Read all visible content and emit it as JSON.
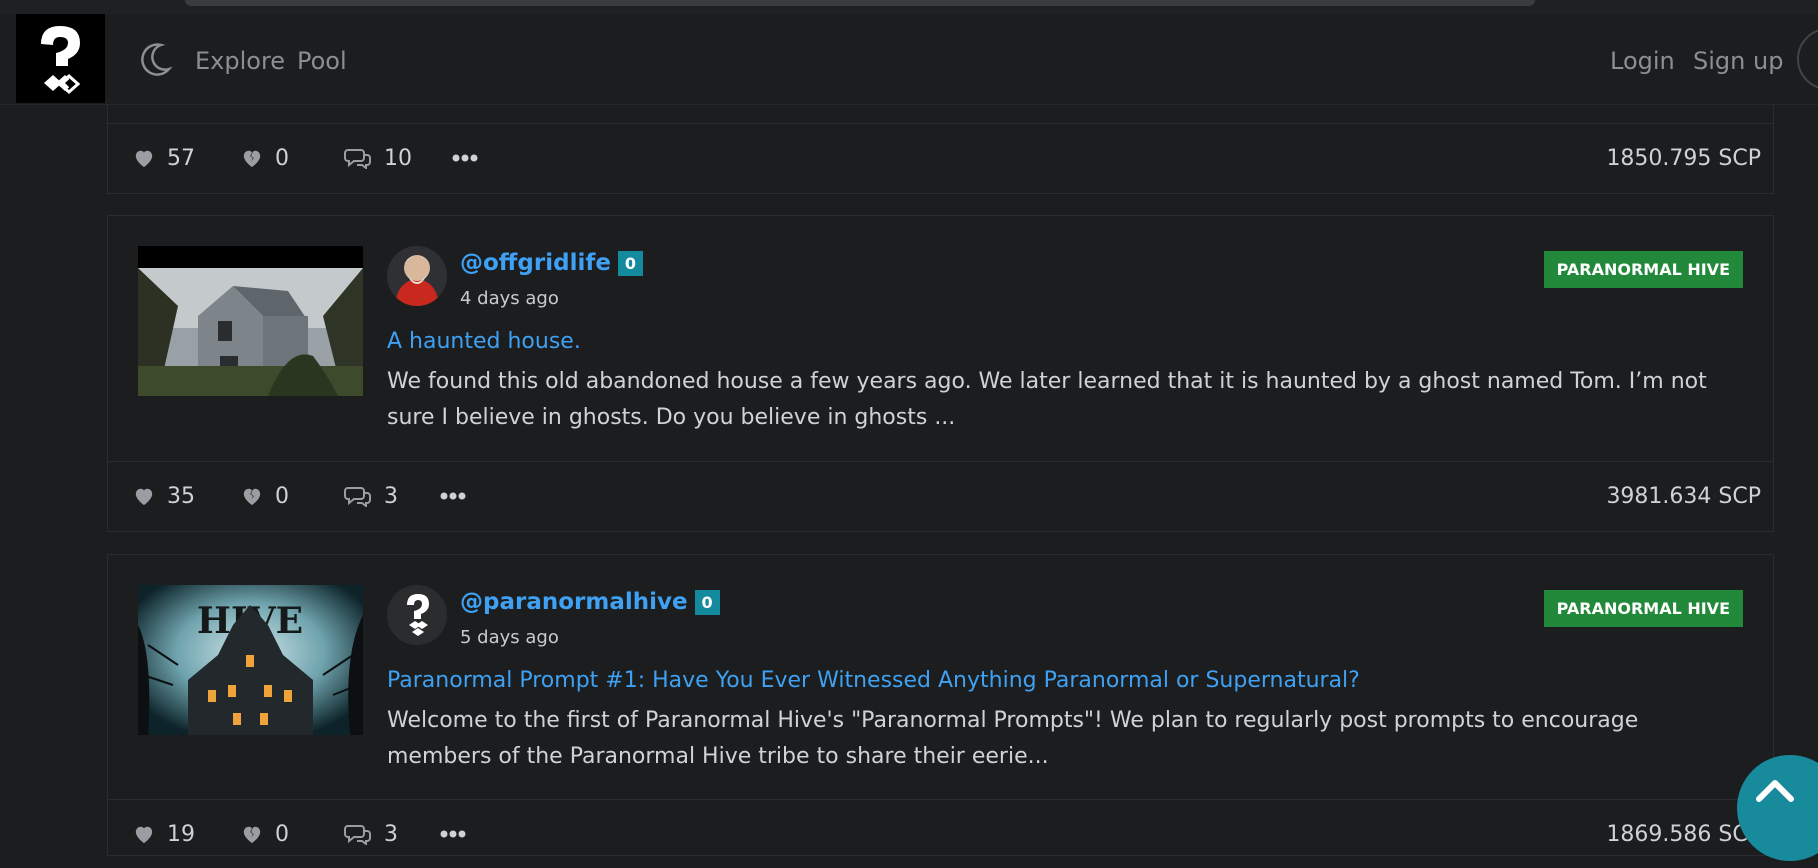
{
  "nav": {
    "links": [
      "Explore",
      "Pool"
    ],
    "login": "Login",
    "signup": "Sign up"
  },
  "posts": [
    {
      "likes": "57",
      "dislikes": "0",
      "comments": "10",
      "payout": "1850.795 SCP"
    },
    {
      "author": "@offgridlife",
      "reputation": "0",
      "time": "4 days ago",
      "community": "PARANORMAL HIVE",
      "title": "A haunted house.",
      "excerpt": "We found this old abandoned house a few years ago. We later learned that it is haunted by a ghost named Tom. I’m not sure I believe in ghosts. Do you believe in ghosts ...",
      "likes": "35",
      "dislikes": "0",
      "comments": "3",
      "payout": "3981.634 SCP"
    },
    {
      "author": "@paranormalhive",
      "reputation": "0",
      "time": "5 days ago",
      "community": "PARANORMAL HIVE",
      "thumbnail_text": "HIVE",
      "title": "Paranormal Prompt #1: Have You Ever Witnessed Anything Paranormal or Supernatural?",
      "excerpt": "Welcome to the first of Paranormal Hive's \"Paranormal Prompts\"! We plan to regularly post prompts to encourage members of the Paranormal Hive tribe to share their eerie...",
      "likes": "19",
      "dislikes": "0",
      "comments": "3",
      "payout": "1869.586 SCP"
    }
  ],
  "colors": {
    "background": "#1b1d1f",
    "link": "#3fa1f3",
    "community_badge": "#22893a",
    "reputation_badge": "#148a9e",
    "scroll_top": "#178a9b"
  },
  "icons": [
    "moon-icon",
    "heart-icon",
    "broken-heart-icon",
    "comment-icon",
    "ellipsis-icon",
    "chevron-up-icon"
  ]
}
